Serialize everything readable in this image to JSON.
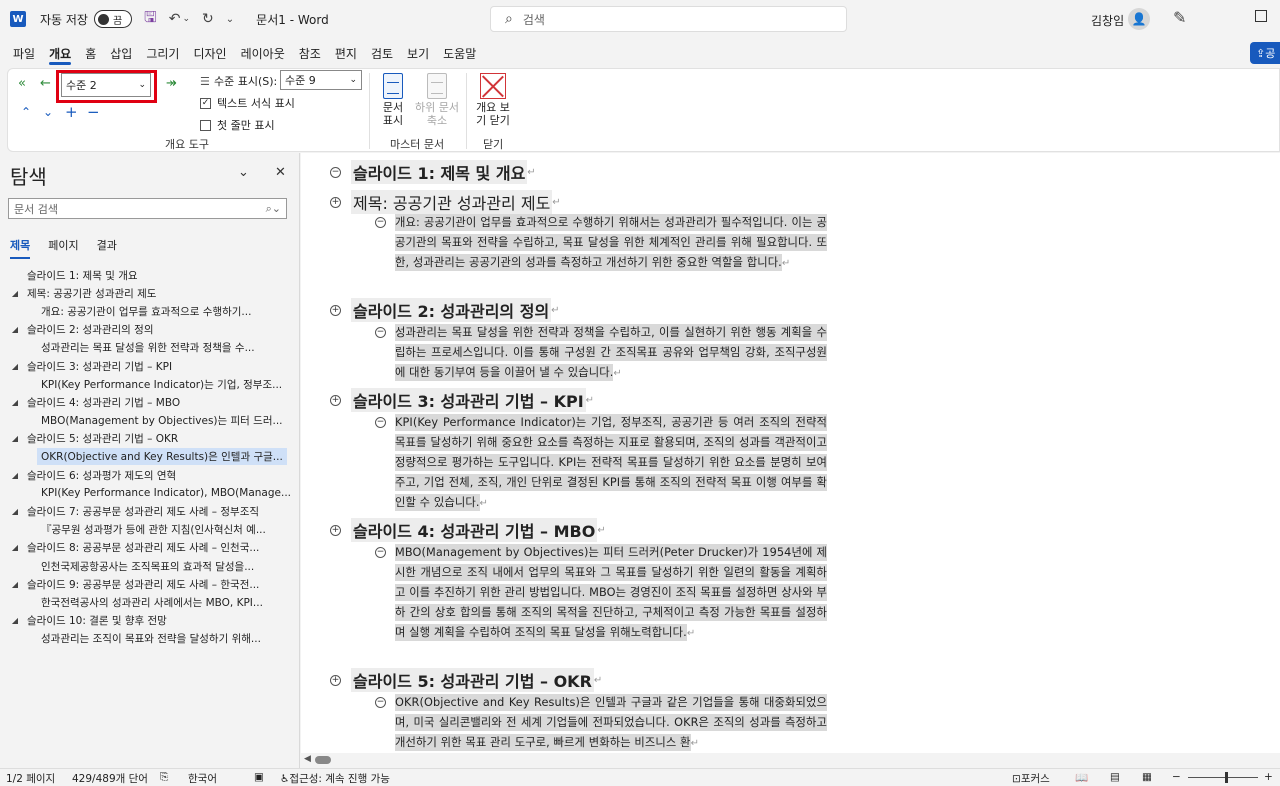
{
  "titlebar": {
    "app_icon": "W",
    "autosave_label": "자동 저장",
    "autosave_state": "끔",
    "doc_title": "문서1 - Word",
    "search_placeholder": "검색",
    "user_name": "김창임",
    "icons": {
      "save": "save-icon",
      "undo": "undo-icon",
      "redo": "redo-icon",
      "customize": "chevron-down-icon"
    }
  },
  "menu": {
    "tabs": [
      "파일",
      "개요",
      "홈",
      "삽입",
      "그리기",
      "디자인",
      "레이아웃",
      "참조",
      "편지",
      "검토",
      "보기",
      "도움말"
    ],
    "active": "개요",
    "share_label": "공"
  },
  "ribbon": {
    "outline_tools": {
      "level_value": "수준 2",
      "show_level_label": "수준 표시(S):",
      "show_level_value": "수준 9",
      "show_text_formatting_label": "텍스트 서식 표시",
      "show_text_formatting_checked": true,
      "show_first_line_only_label": "첫 줄만 표시",
      "show_first_line_only_checked": false,
      "group_label": "개요 도구"
    },
    "master_document": {
      "show_document_label": "문서 표시",
      "collapse_subdocuments_label": "하위 문서 축소",
      "group_label": "마스터 문서"
    },
    "close": {
      "close_outline_label": "개요 보기 닫기",
      "group_label": "닫기"
    }
  },
  "navigation": {
    "title": "탐색",
    "search_placeholder": "문서 검색",
    "tabs": [
      "제목",
      "페이지",
      "결과"
    ],
    "active_tab": "제목",
    "items": [
      {
        "level": 1,
        "expanded": null,
        "label": "슬라이드 1: 제목 및 개요",
        "selected": false
      },
      {
        "level": 1,
        "expanded": true,
        "label": "제목: 공공기관 성과관리 제도",
        "selected": false
      },
      {
        "level": 2,
        "expanded": null,
        "label": "개요: 공공기관이 업무를 효과적으로 수행하기...",
        "selected": false
      },
      {
        "level": 1,
        "expanded": true,
        "label": "슬라이드 2: 성과관리의 정의",
        "selected": false
      },
      {
        "level": 2,
        "expanded": null,
        "label": "성과관리는 목표 달성을 위한 전략과 정책을 수...",
        "selected": false
      },
      {
        "level": 1,
        "expanded": true,
        "label": "슬라이드 3: 성과관리 기법 – KPI",
        "selected": false
      },
      {
        "level": 2,
        "expanded": null,
        "label": "KPI(Key Performance Indicator)는 기업, 정부조...",
        "selected": false
      },
      {
        "level": 1,
        "expanded": true,
        "label": "슬라이드 4: 성과관리 기법 – MBO",
        "selected": false
      },
      {
        "level": 2,
        "expanded": null,
        "label": "MBO(Management by Objectives)는 피터 드러...",
        "selected": false
      },
      {
        "level": 1,
        "expanded": true,
        "label": "슬라이드 5: 성과관리 기법 – OKR",
        "selected": false
      },
      {
        "level": 2,
        "expanded": null,
        "label": "OKR(Objective and Key Results)은 인텔과 구글...",
        "selected": true
      },
      {
        "level": 1,
        "expanded": true,
        "label": "슬라이드 6: 성과평가 제도의 연혁",
        "selected": false
      },
      {
        "level": 2,
        "expanded": null,
        "label": "KPI(Key Performance Indicator), MBO(Manage...",
        "selected": false
      },
      {
        "level": 1,
        "expanded": true,
        "label": "슬라이드 7: 공공부문 성과관리 제도 사례 – 정부조직",
        "selected": false
      },
      {
        "level": 2,
        "expanded": null,
        "label": "『공무원 성과평가 등에 관한 지침(인사혁신처 예...",
        "selected": false
      },
      {
        "level": 1,
        "expanded": true,
        "label": "슬라이드 8: 공공부문 성과관리 제도 사례 – 인천국...",
        "selected": false
      },
      {
        "level": 2,
        "expanded": null,
        "label": "인천국제공항공사는 조직목표의 효과적 달성을...",
        "selected": false
      },
      {
        "level": 1,
        "expanded": true,
        "label": "슬라이드 9: 공공부문 성과관리 제도 사례 – 한국전...",
        "selected": false
      },
      {
        "level": 2,
        "expanded": null,
        "label": "한국전력공사의 성과관리 사례에서는 MBO, KPI...",
        "selected": false
      },
      {
        "level": 1,
        "expanded": true,
        "label": "슬라이드 10: 결론 및 향후 전망",
        "selected": false
      },
      {
        "level": 2,
        "expanded": null,
        "label": "성과관리는 조직이 목표와 전략을 달성하기 위해...",
        "selected": false
      }
    ]
  },
  "document": {
    "blocks": [
      {
        "type": "heading",
        "marker": "−",
        "text": "슬라이드 1: 제목 및 개요",
        "style": "bold"
      },
      {
        "type": "heading",
        "marker": "+",
        "text": "제목: 공공기관 성과관리 제도",
        "style": "normal"
      },
      {
        "type": "body",
        "text": "개요: 공공기관이 업무를 효과적으로 수행하기 위해서는 성과관리가 필수적입니다. 이는 공공기관의 목표와 전략을 수립하고, 목표 달성을 위한 체계적인 관리를 위해 필요합니다. 또한, 성과관리는 공공기관의 성과를 측정하고 개선하기 위한 중요한 역할을 합니다."
      },
      {
        "type": "heading",
        "marker": "+",
        "text": "슬라이드 2: 성과관리의 정의",
        "style": "bold"
      },
      {
        "type": "body",
        "text": "성과관리는 목표 달성을 위한 전략과 정책을 수립하고, 이를 실현하기 위한 행동 계획을 수립하는 프로세스입니다. 이를 통해 구성원 간 조직목표 공유와 업무책임 강화, 조직구성원에 대한 동기부여 등을 이끌어 낼 수 있습니다."
      },
      {
        "type": "heading",
        "marker": "+",
        "text": "슬라이드 3: 성과관리 기법 – KPI",
        "style": "bold"
      },
      {
        "type": "body",
        "text": "KPI(Key Performance Indicator)는 기업, 정부조직, 공공기관 등 여러 조직의 전략적 목표를 달성하기 위해 중요한 요소를 측정하는 지표로 활용되며, 조직의 성과를 객관적이고 정량적으로 평가하는 도구입니다. KPI는 전략적 목표를 달성하기 위한 요소를 분명히 보여주고, 기업 전체, 조직, 개인 단위로 결정된 KPI를 통해 조직의 전략적 목표 이행 여부를 확인할 수 있습니다."
      },
      {
        "type": "heading",
        "marker": "+",
        "text": "슬라이드 4: 성과관리 기법 – MBO",
        "style": "bold"
      },
      {
        "type": "body",
        "text": "MBO(Management by Objectives)는 피터 드러커(Peter Drucker)가 1954년에 제시한 개념으로 조직 내에서 업무의 목표와 그 목표를 달성하기 위한 일련의 활동을 계획하고 이를 추진하기 위한 관리 방법입니다. MBO는 경영진이 조직 목표를 설정하면 상사와 부하 간의 상호 합의를 통해 조직의 목적을 진단하고, 구체적이고 측정 가능한 목표를 설정하며 실행 계획을 수립하여 조직의 목표 달성을 위해노력합니다."
      },
      {
        "type": "heading",
        "marker": "+",
        "text": "슬라이드 5: 성과관리 기법 – OKR",
        "style": "bold"
      },
      {
        "type": "body",
        "text": "OKR(Objective and Key Results)은 인텔과 구글과 같은 기업들을 통해 대중화되었으며, 미국 실리콘밸리와 전 세계 기업들에 전파되었습니다. OKR은 조직의 성과를 측정하고 개선하기 위한 목표 관리 도구로, 빠르게 변화하는 비즈니스 환"
      }
    ],
    "para_mark": "↵"
  },
  "status": {
    "page": "1/2 페이지",
    "words": "429/489개 단어",
    "language": "한국어",
    "accessibility": "접근성: 계속 진행 가능",
    "focus": "포커스"
  }
}
